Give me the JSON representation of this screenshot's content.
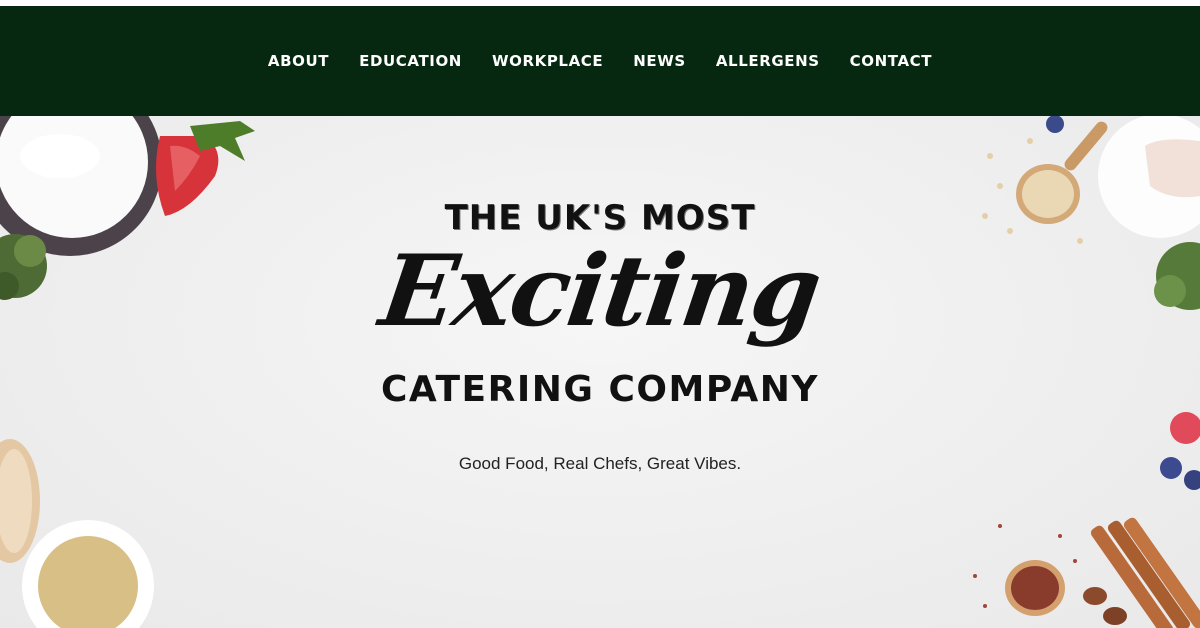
{
  "nav": {
    "items": [
      {
        "label": "ABOUT"
      },
      {
        "label": "EDUCATION"
      },
      {
        "label": "WORKPLACE"
      },
      {
        "label": "NEWS"
      },
      {
        "label": "ALLERGENS"
      },
      {
        "label": "CONTACT"
      }
    ]
  },
  "hero": {
    "line1": "THE UK'S MOST",
    "line2": "Exciting",
    "line3": "CATERING COMPANY",
    "tagline": "Good Food, Real Chefs, Great Vibes."
  },
  "colors": {
    "nav_background": "#062810",
    "nav_text": "#ffffff",
    "hero_background": "#eeeeee",
    "heading_text": "#111111"
  }
}
